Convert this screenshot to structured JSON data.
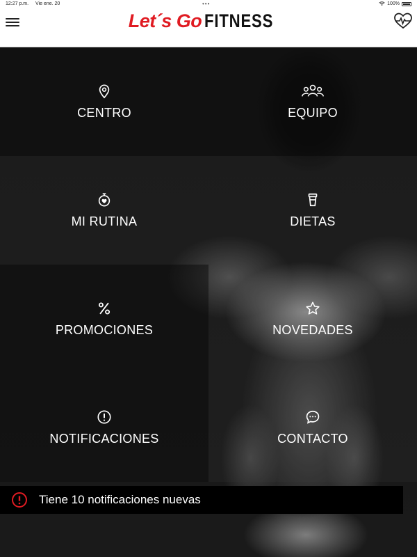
{
  "status_bar": {
    "time": "12:27 p.m.",
    "date": "Vie ene. 20",
    "battery": "100%"
  },
  "header": {
    "logo_part1": "Let´s Go",
    "logo_part2": "FITNESS",
    "menu_icon": "hamburger-icon",
    "right_icon": "heart-pulse-icon"
  },
  "menu": [
    {
      "label": "CENTRO",
      "icon": "location-pin-icon"
    },
    {
      "label": "EQUIPO",
      "icon": "team-icon"
    },
    {
      "label": "MI RUTINA",
      "icon": "stopwatch-heart-icon"
    },
    {
      "label": "DIETAS",
      "icon": "shake-cup-icon"
    },
    {
      "label": "PROMOCIONES",
      "icon": "percent-icon"
    },
    {
      "label": "NOVEDADES",
      "icon": "star-icon"
    },
    {
      "label": "NOTIFICACIONES",
      "icon": "alert-circle-icon"
    },
    {
      "label": "CONTACTO",
      "icon": "chat-bubble-icon"
    }
  ],
  "notification": {
    "text": "Tiene 10 notificaciones nuevas",
    "icon": "alert-circle-icon",
    "icon_color": "#e01b22"
  },
  "colors": {
    "brand_red": "#e01b22",
    "header_bg": "#ffffff",
    "text_light": "#ffffff"
  }
}
